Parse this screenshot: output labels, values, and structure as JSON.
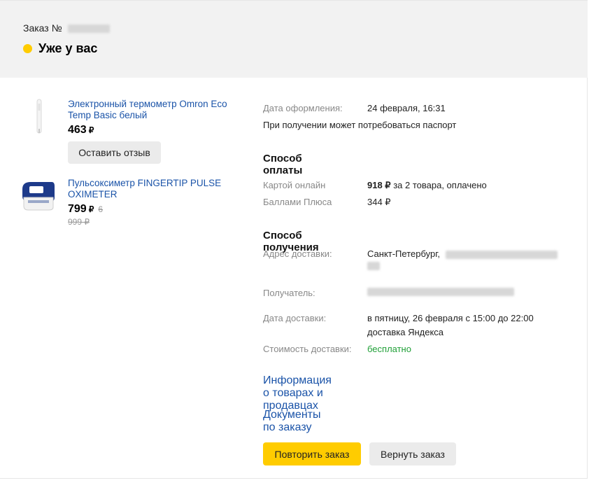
{
  "header": {
    "order_label": "Заказ №",
    "status": "Уже у вас",
    "status_color": "#ffcc00"
  },
  "products": [
    {
      "name": "Электронный термометр Omron Eco Temp Basic белый",
      "price": "463",
      "currency": "₽",
      "review_button": "Оставить отзыв"
    },
    {
      "name": "Пульсоксиметр FINGERTIP PULSE OXIMETER",
      "price": "799",
      "currency": "₽",
      "old_price": "6 999 ₽"
    }
  ],
  "order_info": {
    "date_label": "Дата оформления:",
    "date_value": "24 февраля, 16:31",
    "passport_note": "При получении может потребоваться паспорт"
  },
  "payment": {
    "title": "Способ оплаты",
    "card_label": "Картой онлайн",
    "card_amount": "918 ₽",
    "card_rest": " за 2 товара, оплачено",
    "points_label": "Баллами Плюса",
    "points_value": "344 ₽"
  },
  "delivery": {
    "title": "Способ получения",
    "address_label": "Адрес доставки:",
    "address_value": "Санкт-Петербург,",
    "recipient_label": "Получатель:",
    "date_label": "Дата доставки:",
    "date_value_line1": "в пятницу, 26 февраля с 15:00 до 22:00",
    "date_value_line2": "доставка Яндекса",
    "cost_label": "Стоимость доставки:",
    "cost_value": "бесплатно"
  },
  "links": {
    "products_info": "Информация о товарах и продавцах",
    "documents": "Документы по заказу"
  },
  "actions": {
    "repeat": "Повторить заказ",
    "return": "Вернуть заказ"
  },
  "colors": {
    "link": "#1a53a8",
    "accent_yellow": "#ffcc00",
    "free_green": "#21a038"
  }
}
